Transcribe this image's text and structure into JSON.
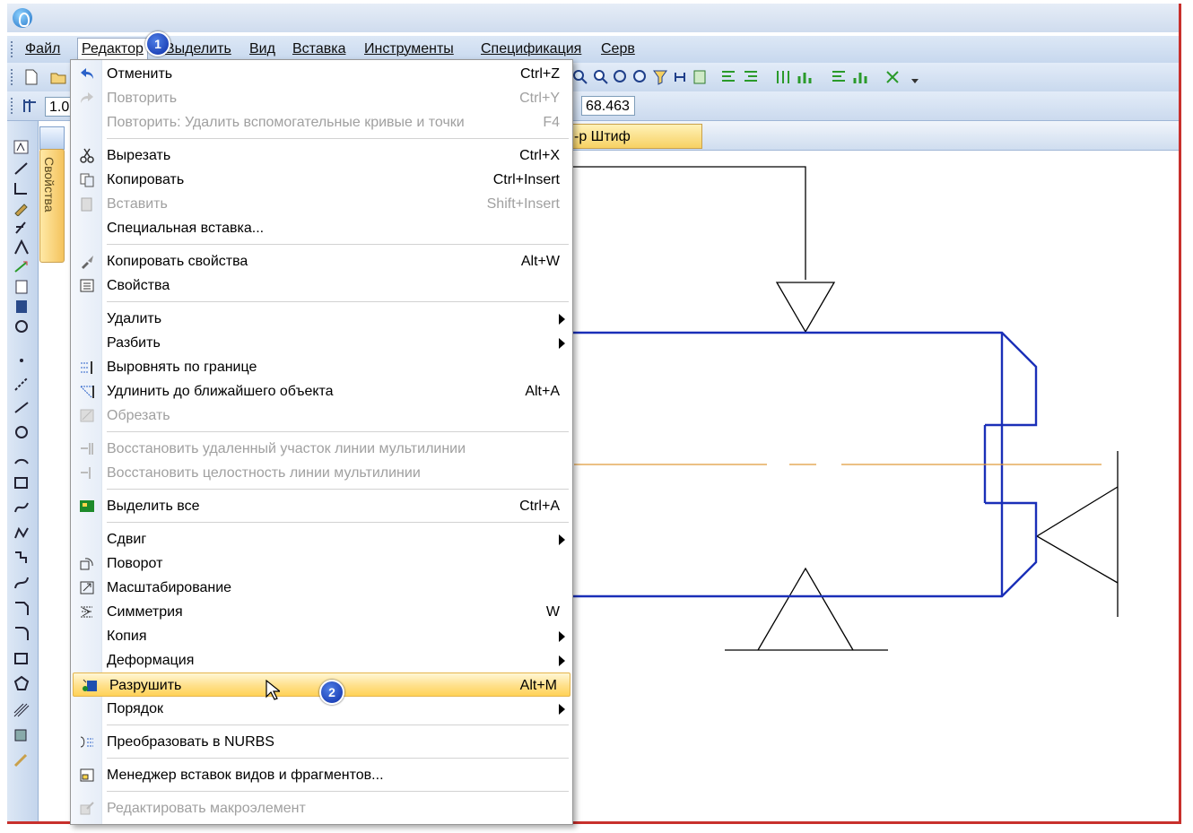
{
  "menubar": {
    "items": [
      "Файл",
      "Редактор",
      "Выделить",
      "Вид",
      "Вставка",
      "Инструменты",
      "Спецификация",
      "Серв"
    ]
  },
  "toolbar2": {
    "scale_value": "1.0",
    "coord_value": "68.463"
  },
  "document_tab": {
    "label": "-р Штиф"
  },
  "properties_panel": {
    "label": "Свойства"
  },
  "badges": {
    "first": "1",
    "second": "2"
  },
  "edit_menu": {
    "items": [
      {
        "label": "Отменить",
        "shortcut": "Ctrl+Z",
        "icon": "undo-icon"
      },
      {
        "label": "Повторить",
        "shortcut": "Ctrl+Y",
        "icon": "redo-icon"
      },
      {
        "label": "Повторить: Удалить вспомогательные кривые и точки",
        "shortcut": "F4"
      },
      {
        "label": "Вырезать",
        "shortcut": "Ctrl+X",
        "icon": "scissors-icon"
      },
      {
        "label": "Копировать",
        "shortcut": "Ctrl+Insert",
        "icon": "copy-icon"
      },
      {
        "label": "Вставить",
        "shortcut": "Shift+Insert",
        "icon": "paste-icon"
      },
      {
        "label": "Специальная вставка...",
        "shortcut": ""
      },
      {
        "label": "Копировать свойства",
        "shortcut": "Alt+W",
        "icon": "brush-icon"
      },
      {
        "label": "Свойства",
        "shortcut": "",
        "icon": "properties-icon"
      },
      {
        "label": "Удалить",
        "shortcut": ""
      },
      {
        "label": "Разбить",
        "shortcut": ""
      },
      {
        "label": "Выровнять по границе",
        "shortcut": "",
        "icon": "align-border-icon"
      },
      {
        "label": "Удлинить до ближайшего объекта",
        "shortcut": "Alt+A",
        "icon": "extend-icon"
      },
      {
        "label": "Обрезать",
        "shortcut": "",
        "icon": "trim-icon"
      },
      {
        "label": "Восстановить удаленный участок линии мультилинии",
        "shortcut": "",
        "icon": "multiline-restore-icon"
      },
      {
        "label": "Восстановить целостность линии мультилинии",
        "shortcut": "",
        "icon": "multiline-integrity-icon"
      },
      {
        "label": "Выделить все",
        "shortcut": "Ctrl+A",
        "icon": "select-all-icon"
      },
      {
        "label": "Сдвиг",
        "shortcut": ""
      },
      {
        "label": "Поворот",
        "shortcut": "",
        "icon": "rotate-icon"
      },
      {
        "label": "Масштабирование",
        "shortcut": "",
        "icon": "scale-icon"
      },
      {
        "label": "Симметрия",
        "shortcut": "W",
        "icon": "symmetry-icon"
      },
      {
        "label": "Копия",
        "shortcut": ""
      },
      {
        "label": "Деформация",
        "shortcut": ""
      },
      {
        "label": "Разрушить",
        "shortcut": "Alt+M",
        "icon": "explode-icon"
      },
      {
        "label": "Порядок",
        "shortcut": ""
      },
      {
        "label": "Преобразовать в NURBS",
        "shortcut": "",
        "icon": "nurbs-icon"
      },
      {
        "label": "Менеджер вставок видов и фрагментов...",
        "shortcut": "",
        "icon": "insert-manager-icon"
      },
      {
        "label": "Редактировать макроэлемент",
        "shortcut": "",
        "icon": "macro-icon"
      }
    ]
  }
}
